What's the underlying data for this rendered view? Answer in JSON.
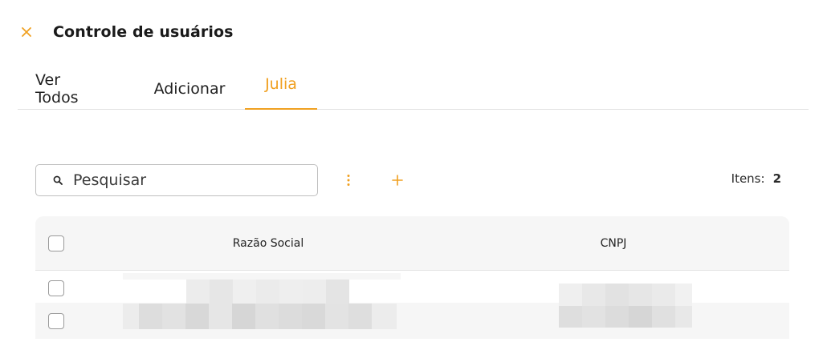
{
  "header": {
    "title": "Controle de usuários",
    "close_icon": "close-icon"
  },
  "tabs": [
    {
      "label": "Ver Todos",
      "active": false
    },
    {
      "label": "Adicionar",
      "active": false
    },
    {
      "label": "Julia",
      "active": true
    }
  ],
  "toolbar": {
    "search_placeholder": "Pesquisar",
    "more_icon": "vertical-dots-icon",
    "add_icon": "plus-icon",
    "items_label": "Itens:",
    "items_count": "2"
  },
  "table": {
    "columns": [
      "Razão Social",
      "CNPJ"
    ],
    "rows": [
      {
        "razao_social": "[pixelated]",
        "cnpj": "[pixelated]"
      },
      {
        "razao_social": "[pixelated]",
        "cnpj": "[pixelated]"
      }
    ]
  },
  "colors": {
    "accent": "#f0a020",
    "text": "#1f1f1f",
    "header_bg": "#f6f6f6",
    "border": "#e2e2e2"
  }
}
